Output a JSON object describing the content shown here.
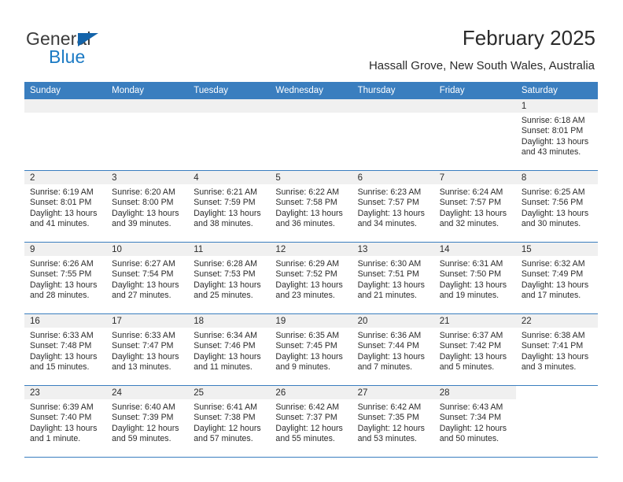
{
  "brand": {
    "name_top": "General",
    "name_bottom": "Blue",
    "accent_color": "#1b7ac4",
    "triangle_color": "#1464aa"
  },
  "header": {
    "title": "February 2025",
    "subtitle": "Hassall Grove, New South Wales, Australia"
  },
  "theme": {
    "header_row_bg": "#3a7ebf",
    "day_strip_bg": "#f0f0f0",
    "row_divider": "#3a7ebf",
    "text": "#2b2b2b"
  },
  "calendar": {
    "weekday_headers": [
      "Sunday",
      "Monday",
      "Tuesday",
      "Wednesday",
      "Thursday",
      "Friday",
      "Saturday"
    ],
    "weeks": [
      [
        {
          "day": "",
          "sunrise": "",
          "sunset": "",
          "daylight": "",
          "empty": true
        },
        {
          "day": "",
          "sunrise": "",
          "sunset": "",
          "daylight": "",
          "empty": true
        },
        {
          "day": "",
          "sunrise": "",
          "sunset": "",
          "daylight": "",
          "empty": true
        },
        {
          "day": "",
          "sunrise": "",
          "sunset": "",
          "daylight": "",
          "empty": true
        },
        {
          "day": "",
          "sunrise": "",
          "sunset": "",
          "daylight": "",
          "empty": true
        },
        {
          "day": "",
          "sunrise": "",
          "sunset": "",
          "daylight": "",
          "empty": true
        },
        {
          "day": "1",
          "sunrise": "Sunrise: 6:18 AM",
          "sunset": "Sunset: 8:01 PM",
          "daylight": "Daylight: 13 hours and 43 minutes.",
          "empty": false
        }
      ],
      [
        {
          "day": "2",
          "sunrise": "Sunrise: 6:19 AM",
          "sunset": "Sunset: 8:01 PM",
          "daylight": "Daylight: 13 hours and 41 minutes.",
          "empty": false
        },
        {
          "day": "3",
          "sunrise": "Sunrise: 6:20 AM",
          "sunset": "Sunset: 8:00 PM",
          "daylight": "Daylight: 13 hours and 39 minutes.",
          "empty": false
        },
        {
          "day": "4",
          "sunrise": "Sunrise: 6:21 AM",
          "sunset": "Sunset: 7:59 PM",
          "daylight": "Daylight: 13 hours and 38 minutes.",
          "empty": false
        },
        {
          "day": "5",
          "sunrise": "Sunrise: 6:22 AM",
          "sunset": "Sunset: 7:58 PM",
          "daylight": "Daylight: 13 hours and 36 minutes.",
          "empty": false
        },
        {
          "day": "6",
          "sunrise": "Sunrise: 6:23 AM",
          "sunset": "Sunset: 7:57 PM",
          "daylight": "Daylight: 13 hours and 34 minutes.",
          "empty": false
        },
        {
          "day": "7",
          "sunrise": "Sunrise: 6:24 AM",
          "sunset": "Sunset: 7:57 PM",
          "daylight": "Daylight: 13 hours and 32 minutes.",
          "empty": false
        },
        {
          "day": "8",
          "sunrise": "Sunrise: 6:25 AM",
          "sunset": "Sunset: 7:56 PM",
          "daylight": "Daylight: 13 hours and 30 minutes.",
          "empty": false
        }
      ],
      [
        {
          "day": "9",
          "sunrise": "Sunrise: 6:26 AM",
          "sunset": "Sunset: 7:55 PM",
          "daylight": "Daylight: 13 hours and 28 minutes.",
          "empty": false
        },
        {
          "day": "10",
          "sunrise": "Sunrise: 6:27 AM",
          "sunset": "Sunset: 7:54 PM",
          "daylight": "Daylight: 13 hours and 27 minutes.",
          "empty": false
        },
        {
          "day": "11",
          "sunrise": "Sunrise: 6:28 AM",
          "sunset": "Sunset: 7:53 PM",
          "daylight": "Daylight: 13 hours and 25 minutes.",
          "empty": false
        },
        {
          "day": "12",
          "sunrise": "Sunrise: 6:29 AM",
          "sunset": "Sunset: 7:52 PM",
          "daylight": "Daylight: 13 hours and 23 minutes.",
          "empty": false
        },
        {
          "day": "13",
          "sunrise": "Sunrise: 6:30 AM",
          "sunset": "Sunset: 7:51 PM",
          "daylight": "Daylight: 13 hours and 21 minutes.",
          "empty": false
        },
        {
          "day": "14",
          "sunrise": "Sunrise: 6:31 AM",
          "sunset": "Sunset: 7:50 PM",
          "daylight": "Daylight: 13 hours and 19 minutes.",
          "empty": false
        },
        {
          "day": "15",
          "sunrise": "Sunrise: 6:32 AM",
          "sunset": "Sunset: 7:49 PM",
          "daylight": "Daylight: 13 hours and 17 minutes.",
          "empty": false
        }
      ],
      [
        {
          "day": "16",
          "sunrise": "Sunrise: 6:33 AM",
          "sunset": "Sunset: 7:48 PM",
          "daylight": "Daylight: 13 hours and 15 minutes.",
          "empty": false
        },
        {
          "day": "17",
          "sunrise": "Sunrise: 6:33 AM",
          "sunset": "Sunset: 7:47 PM",
          "daylight": "Daylight: 13 hours and 13 minutes.",
          "empty": false
        },
        {
          "day": "18",
          "sunrise": "Sunrise: 6:34 AM",
          "sunset": "Sunset: 7:46 PM",
          "daylight": "Daylight: 13 hours and 11 minutes.",
          "empty": false
        },
        {
          "day": "19",
          "sunrise": "Sunrise: 6:35 AM",
          "sunset": "Sunset: 7:45 PM",
          "daylight": "Daylight: 13 hours and 9 minutes.",
          "empty": false
        },
        {
          "day": "20",
          "sunrise": "Sunrise: 6:36 AM",
          "sunset": "Sunset: 7:44 PM",
          "daylight": "Daylight: 13 hours and 7 minutes.",
          "empty": false
        },
        {
          "day": "21",
          "sunrise": "Sunrise: 6:37 AM",
          "sunset": "Sunset: 7:42 PM",
          "daylight": "Daylight: 13 hours and 5 minutes.",
          "empty": false
        },
        {
          "day": "22",
          "sunrise": "Sunrise: 6:38 AM",
          "sunset": "Sunset: 7:41 PM",
          "daylight": "Daylight: 13 hours and 3 minutes.",
          "empty": false
        }
      ],
      [
        {
          "day": "23",
          "sunrise": "Sunrise: 6:39 AM",
          "sunset": "Sunset: 7:40 PM",
          "daylight": "Daylight: 13 hours and 1 minute.",
          "empty": false
        },
        {
          "day": "24",
          "sunrise": "Sunrise: 6:40 AM",
          "sunset": "Sunset: 7:39 PM",
          "daylight": "Daylight: 12 hours and 59 minutes.",
          "empty": false
        },
        {
          "day": "25",
          "sunrise": "Sunrise: 6:41 AM",
          "sunset": "Sunset: 7:38 PM",
          "daylight": "Daylight: 12 hours and 57 minutes.",
          "empty": false
        },
        {
          "day": "26",
          "sunrise": "Sunrise: 6:42 AM",
          "sunset": "Sunset: 7:37 PM",
          "daylight": "Daylight: 12 hours and 55 minutes.",
          "empty": false
        },
        {
          "day": "27",
          "sunrise": "Sunrise: 6:42 AM",
          "sunset": "Sunset: 7:35 PM",
          "daylight": "Daylight: 12 hours and 53 minutes.",
          "empty": false
        },
        {
          "day": "28",
          "sunrise": "Sunrise: 6:43 AM",
          "sunset": "Sunset: 7:34 PM",
          "daylight": "Daylight: 12 hours and 50 minutes.",
          "empty": false
        },
        {
          "day": "",
          "sunrise": "",
          "sunset": "",
          "daylight": "",
          "empty": true
        }
      ]
    ]
  }
}
